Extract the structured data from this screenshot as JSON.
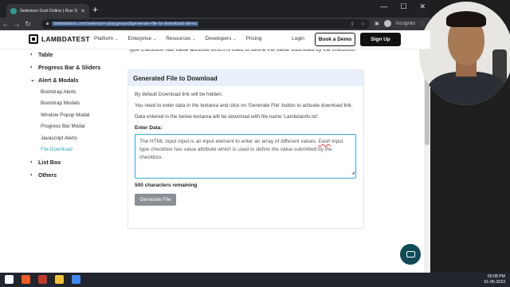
{
  "browser": {
    "tab_title": "Selenium Grid Online | Run Selenium",
    "tab_close": "✕",
    "new_tab": "+",
    "url": "lambdatest.com/selenium-playground/generate-file-to-download-demo",
    "profile_label": "Incognito",
    "win_min": "—",
    "win_max": "☐",
    "win_close": "✕"
  },
  "header": {
    "logo_text": "LAMBDATEST",
    "nav": [
      "Platform",
      "Enterprise",
      "Resources",
      "Developers",
      "Pricing"
    ],
    "login": "Login",
    "book_demo": "Book a Demo",
    "sign_up": "Sign Up"
  },
  "peek_text": "type checkbox has value attribute which is used to define the value submitted by the checkbox.",
  "sidebar": {
    "groups": [
      {
        "label": "Table",
        "chev": "›"
      },
      {
        "label": "Progress Bar & Sliders",
        "chev": "›"
      },
      {
        "label": "Alert & Modals",
        "chev": "⌄"
      }
    ],
    "items": [
      "Bootstrap Alerts",
      "Bootstrap Modals",
      "Window Popup Modal",
      "Progress Bar Modal",
      "Javascript Alerts",
      "File Download"
    ],
    "after_groups": [
      {
        "label": "List Box",
        "chev": "›"
      },
      {
        "label": "Others",
        "chev": "›"
      }
    ]
  },
  "card": {
    "title": "Generated File to Download",
    "p1": "By default Download link will be hidden.",
    "p2": "You need to enter data in the textarea and click on 'Generate File' button to activate download link.",
    "p3": "Data entered in the below textarea will be download with file name 'Lambdainfo.txt'.",
    "field_label": "Enter Data:",
    "textarea_value_a": "The HTML input input is an input element to enter an array of different values. ",
    "textarea_value_typo": "Eash",
    "textarea_value_b": " input type checkbox has value attribute which is used to define the value submitted by the checkbox.",
    "remaining": "500 characters remaining",
    "generate_button": "Generate File"
  },
  "taskbar": {
    "time": "05:08 PM",
    "date": "01-05-2023",
    "icons": [
      {
        "name": "windows-start-icon",
        "color": "#ffffff"
      },
      {
        "name": "brave-icon",
        "color": "#f05a24"
      },
      {
        "name": "app-icon",
        "color": "#c0392b"
      },
      {
        "name": "file-explorer-icon",
        "color": "#f3c13a"
      },
      {
        "name": "chrome-icon",
        "color": "#4285f4"
      }
    ]
  }
}
